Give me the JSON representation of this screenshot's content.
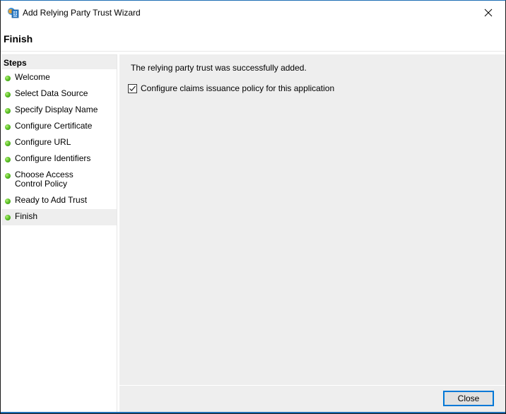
{
  "window": {
    "title": "Add Relying Party Trust Wizard",
    "icon": "adfs-server-icon",
    "close_icon": "close-icon"
  },
  "page": {
    "title": "Finish"
  },
  "steps": {
    "header": "Steps",
    "items": [
      {
        "label": "Welcome",
        "status": "complete"
      },
      {
        "label": "Select Data Source",
        "status": "complete"
      },
      {
        "label": "Specify Display Name",
        "status": "complete"
      },
      {
        "label": "Configure Certificate",
        "status": "complete"
      },
      {
        "label": "Configure URL",
        "status": "complete"
      },
      {
        "label": "Configure Identifiers",
        "status": "complete"
      },
      {
        "label": "Choose Access Control Policy",
        "status": "complete"
      },
      {
        "label": "Ready to Add Trust",
        "status": "complete"
      },
      {
        "label": "Finish",
        "status": "current"
      }
    ],
    "status_color": "#5fc328"
  },
  "content": {
    "message": "The relying party trust was successfully added.",
    "checkbox": {
      "label": "Configure claims issuance policy for this application",
      "checked": true
    }
  },
  "footer": {
    "close_label": "Close"
  },
  "colors": {
    "accent": "#0078d7",
    "panel_bg": "#eeeeee"
  }
}
